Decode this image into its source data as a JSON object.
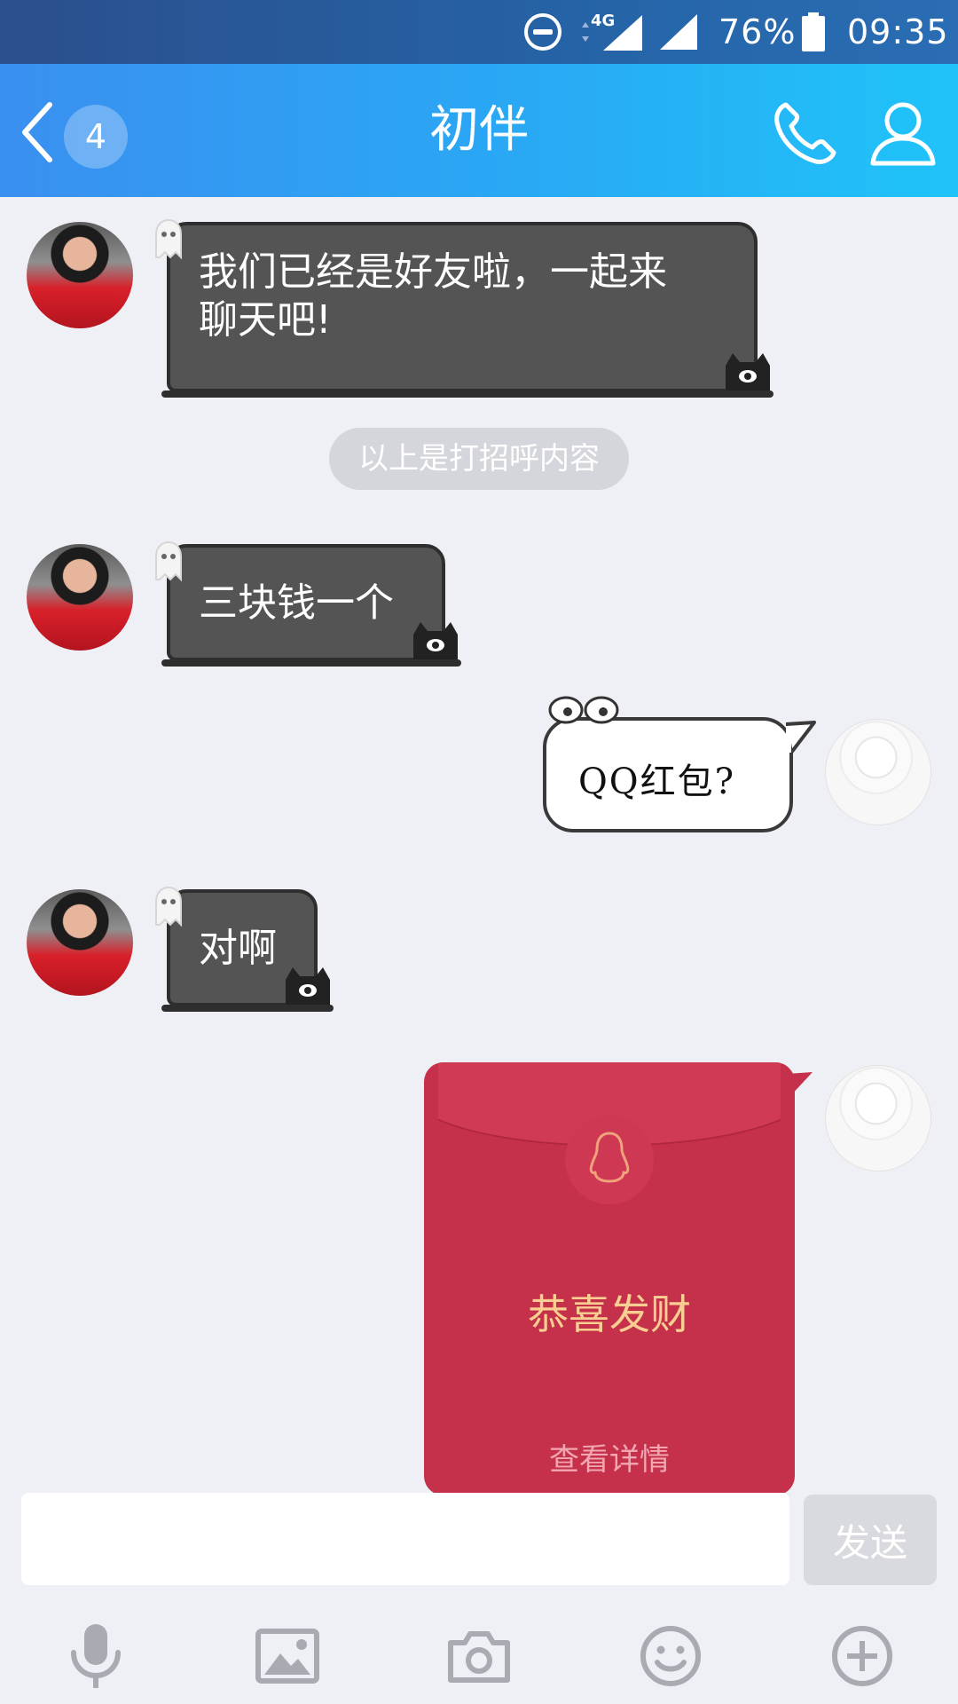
{
  "status_bar": {
    "network": "4G",
    "battery_percent": "76%",
    "time": "09:35"
  },
  "header": {
    "unread_count": "4",
    "title": "初伴"
  },
  "messages": [
    {
      "sender": "friend",
      "text_line1": "我们已经是好友啦，一起来",
      "text_line2": "聊天吧!"
    },
    {
      "sender": "system",
      "text": "以上是打招呼内容"
    },
    {
      "sender": "friend",
      "text": "三块钱一个"
    },
    {
      "sender": "self",
      "text": "QQ红包?"
    },
    {
      "sender": "friend",
      "text": "对啊"
    },
    {
      "sender": "self",
      "type": "red_packet",
      "title": "恭喜发财",
      "detail": "查看详情"
    }
  ],
  "composer": {
    "input_value": "",
    "send_label": "发送"
  },
  "toolbar_icons": [
    "microphone-icon",
    "image-icon",
    "camera-icon",
    "emoji-icon",
    "plus-icon"
  ],
  "colors": {
    "header_start": "#3a8ff0",
    "header_end": "#1fc3f9",
    "red_packet": "#c5304a",
    "red_packet_title": "#f8cf91",
    "background": "#eff0f6"
  }
}
